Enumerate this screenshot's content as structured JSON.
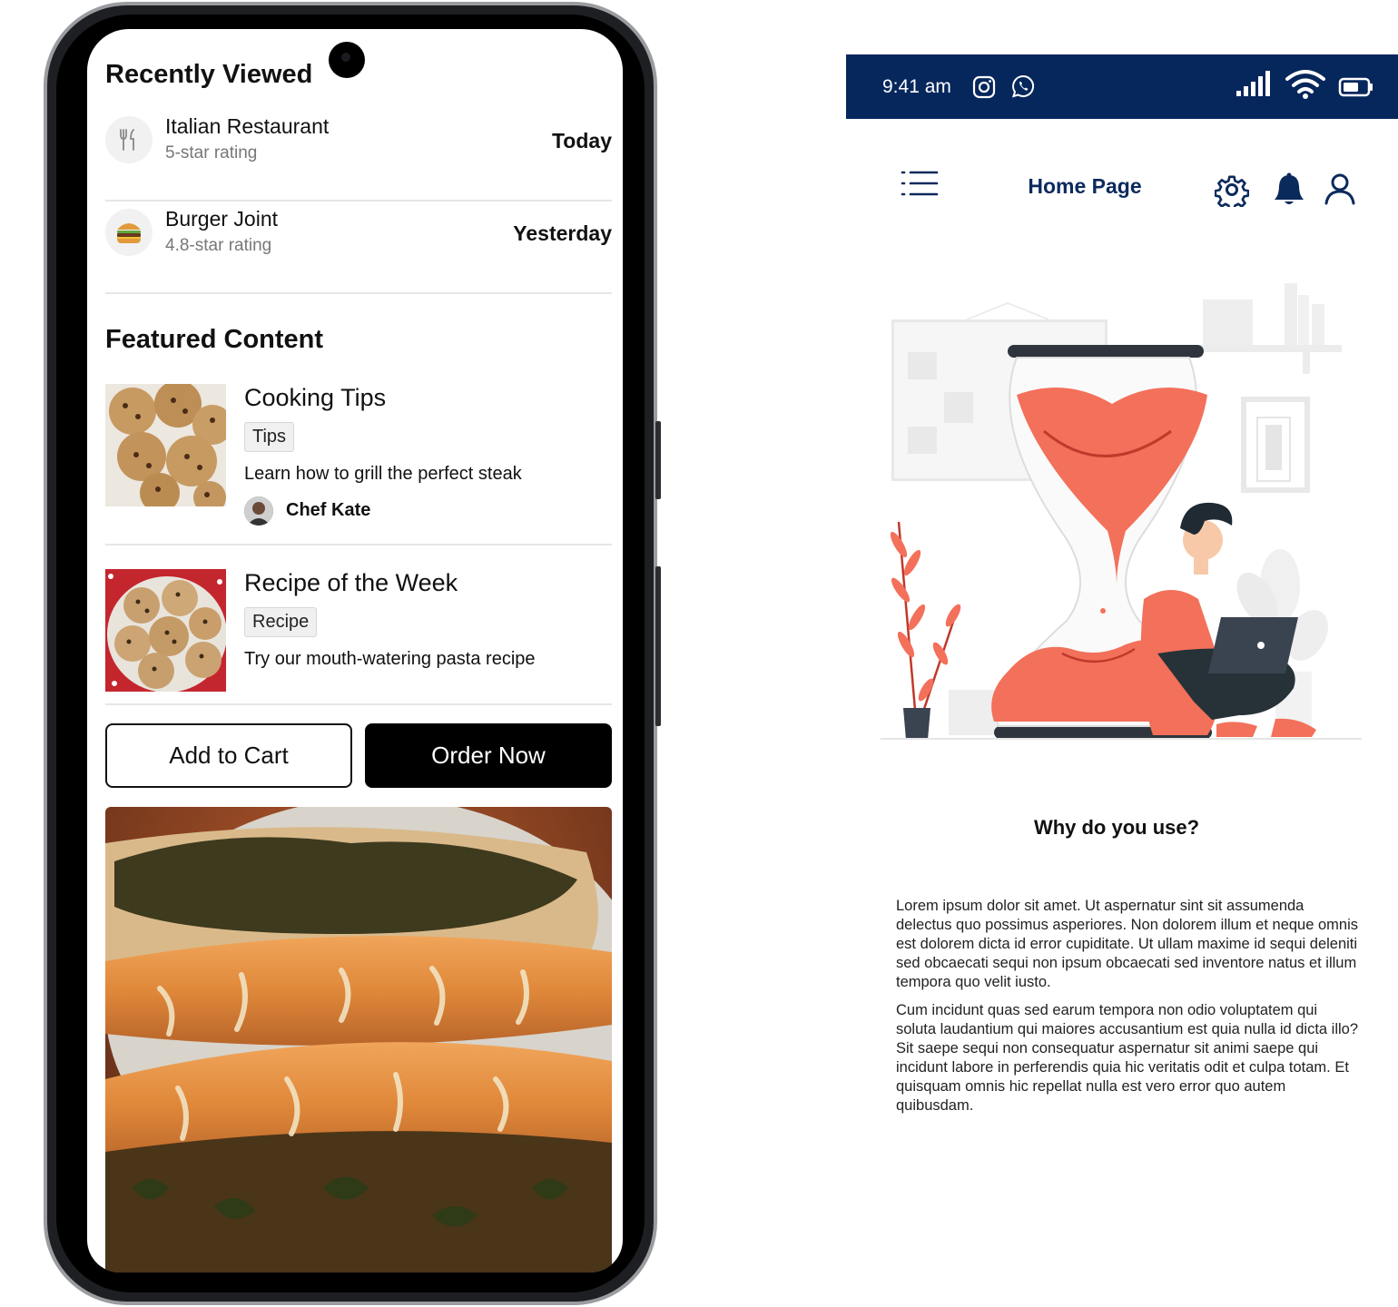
{
  "left_app": {
    "recently_viewed": {
      "heading": "Recently Viewed",
      "items": [
        {
          "name": "Italian Restaurant",
          "rating": "5-star rating",
          "when": "Today",
          "icon": "fork-knife-icon"
        },
        {
          "name": "Burger Joint",
          "rating": "4.8-star rating",
          "when": "Yesterday",
          "icon": "burger-icon"
        }
      ]
    },
    "featured": {
      "heading": "Featured Content",
      "items": [
        {
          "title": "Cooking Tips",
          "tag": "Tips",
          "description": "Learn how to grill the perfect steak",
          "author": "Chef Kate"
        },
        {
          "title": "Recipe of the Week",
          "tag": "Recipe",
          "description": "Try our mouth-watering pasta recipe"
        }
      ]
    },
    "actions": {
      "add_to_cart": "Add to Cart",
      "order_now": "Order Now"
    }
  },
  "right_app": {
    "status_bar": {
      "time": "9:41 am",
      "background": "#06275c"
    },
    "nav": {
      "title": "Home Page",
      "icons": [
        "menu-icon",
        "settings-icon",
        "bell-icon",
        "user-icon"
      ]
    },
    "section_title": "Why do you use?",
    "paragraphs": [
      "Lorem ipsum dolor sit amet. Ut aspernatur sint sit assumenda delectus quo possimus asperiores. Non dolorem illum et neque omnis est dolorem dicta id error cupiditate. Ut ullam maxime id sequi deleniti sed obcaecati sequi non ipsum obcaecati sed inventore natus et illum tempora quo velit iusto.",
      "Cum incidunt quas sed earum tempora non odio voluptatem qui soluta laudantium qui maiores accusantium est quia nulla id dicta illo? Sit saepe sequi non consequatur aspernatur sit animi saepe qui incidunt labore in perferendis quia hic veritatis odit et culpa totam. Et quisquam omnis hic repellat nulla est vero error quo autem quibusdam."
    ],
    "accent_color": "#f3705a"
  }
}
